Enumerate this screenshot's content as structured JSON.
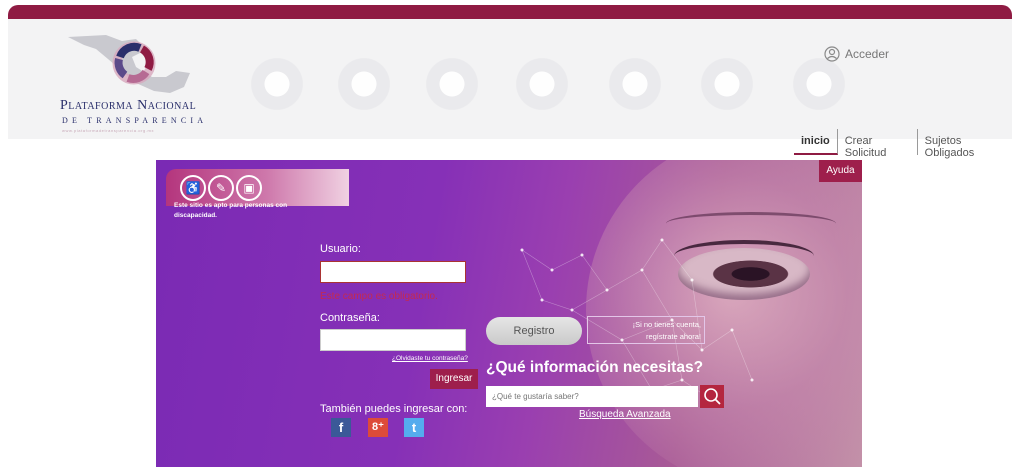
{
  "header": {
    "logo": {
      "line1": "Plataforma Nacional",
      "line2": "de Transparencia",
      "url": "www.plataformadetransparencia.org.mx"
    },
    "account": {
      "label": "Acceder",
      "icon": "user-circle-icon"
    },
    "nav": [
      {
        "label": "inicio"
      },
      {
        "label": "Crear Solicitud"
      },
      {
        "label": "Sujetos Obligados"
      }
    ],
    "colors": {
      "brand": "#8f1b43",
      "logo_text": "#2a2f6b"
    }
  },
  "hero": {
    "accessibility": {
      "icons": [
        "wheelchair-icon",
        "hearing-impaired-icon",
        "sign-language-icon"
      ],
      "note": "Este sitio es apto para personas con discapacidad."
    },
    "help_label": "Ayuda",
    "login": {
      "user_label": "Usuario:",
      "user_error": "Este campo es obligatorio.",
      "password_label": "Contraseña:",
      "forgot_label": "¿Olvidaste tu contraseña?",
      "submit_label": "Ingresar",
      "social_label": "También puedes ingresar con:",
      "social": [
        {
          "name": "facebook",
          "glyph": "f",
          "color": "#3b5998"
        },
        {
          "name": "google-plus",
          "glyph": "8⁺",
          "color": "#dd4b39"
        },
        {
          "name": "twitter",
          "glyph": "t",
          "color": "#55acee"
        }
      ]
    },
    "register": {
      "button_label": "Registro",
      "note_line1": "¡Si no tienes cuenta,",
      "note_line2": "regístrate ahora!"
    },
    "search": {
      "title": "¿Qué información necesitas?",
      "placeholder": "¿Qué te gustaría saber?",
      "advanced_label": "Búsqueda Avanzada"
    },
    "colors": {
      "purple": "#7a2ab4",
      "accent": "#9e1f4c"
    }
  }
}
